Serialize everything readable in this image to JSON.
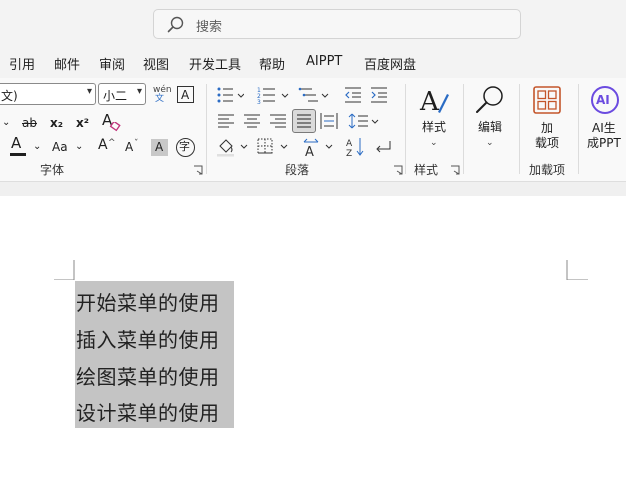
{
  "search": {
    "placeholder": "搜索"
  },
  "tabs": [
    "引用",
    "邮件",
    "审阅",
    "视图",
    "开发工具",
    "帮助",
    "AIPPT",
    "百度网盘"
  ],
  "ribbon": {
    "font": {
      "font_name_value": "文)",
      "font_size_value": "小二",
      "phonetic_top": "wén",
      "phonetic_bottom": "文",
      "char_border": "A",
      "strike": "ab",
      "subscript": "x₂",
      "superscript": "x²",
      "clear_format": "A",
      "font_color": "A",
      "change_case": "Aa",
      "grow_font": "A",
      "shrink_font": "A",
      "char_shading": "A",
      "enclose_char": "字",
      "group_label": "字体"
    },
    "paragraph": {
      "group_label": "段落"
    },
    "styles": {
      "button_label": "样式",
      "group_label": "样式"
    },
    "editing": {
      "button_label": "编辑"
    },
    "addins": {
      "button_label_line1": "加",
      "button_label_line2": "载项",
      "group_label": "加载项"
    },
    "aippt": {
      "badge": "AI",
      "button_label_line1": "AI生",
      "button_label_line2": "成PPT"
    }
  },
  "colors": {
    "font_color_bar": "#1f1f1f",
    "highlight_bar": "#e0e0e0",
    "addins_accent": "#c4562b",
    "ai_accent": "#6b4be0"
  },
  "document": {
    "lines": [
      "开始菜单的使用",
      "插入菜单的使用",
      "绘图菜单的使用",
      "设计菜单的使用"
    ]
  }
}
